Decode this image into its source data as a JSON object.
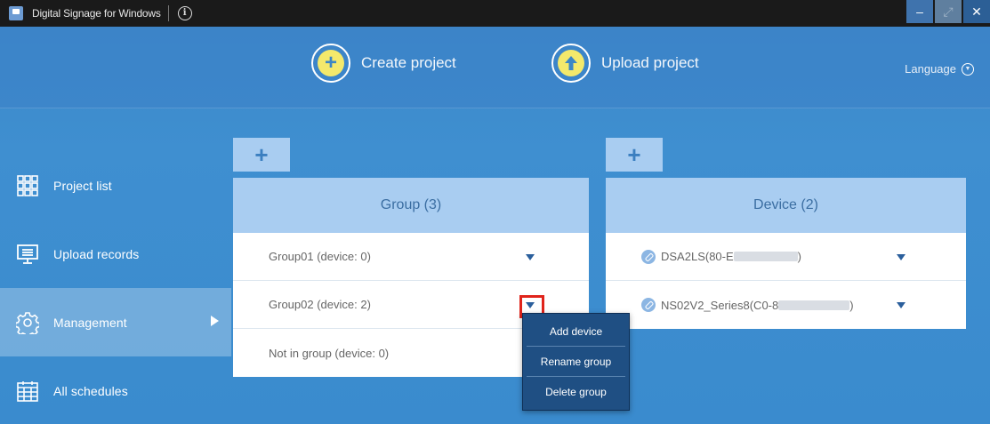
{
  "window": {
    "title": "Digital Signage for Windows",
    "info_icon": "info-icon",
    "controls": [
      "–",
      "⤢",
      "✕"
    ]
  },
  "header": {
    "create_label": "Create project",
    "upload_label": "Upload project",
    "language_label": "Language"
  },
  "sidebar": {
    "items": [
      {
        "label": "Project list",
        "icon": "grid-icon"
      },
      {
        "label": "Upload records",
        "icon": "monitor-list-icon"
      },
      {
        "label": "Management",
        "icon": "gear-icon",
        "active": true
      },
      {
        "label": "All schedules",
        "icon": "calendar-icon"
      }
    ]
  },
  "groups": {
    "add_label": "+",
    "title": "Group (3)",
    "rows": [
      {
        "label": "Group01 (device: 0)",
        "has_menu": true
      },
      {
        "label": "Group02 (device: 2)",
        "has_menu": true
      },
      {
        "label": "Not in group (device: 0)",
        "has_menu": false
      }
    ]
  },
  "devices": {
    "add_label": "+",
    "title": "Device (2)",
    "rows": [
      {
        "prefix": "DSA2LS(80-E",
        "suffix": ")"
      },
      {
        "prefix": "NS02V2_Series8(C0-8",
        "suffix": ")"
      }
    ]
  },
  "context_menu": {
    "items": [
      "Add device",
      "Rename group",
      "Delete group"
    ]
  }
}
